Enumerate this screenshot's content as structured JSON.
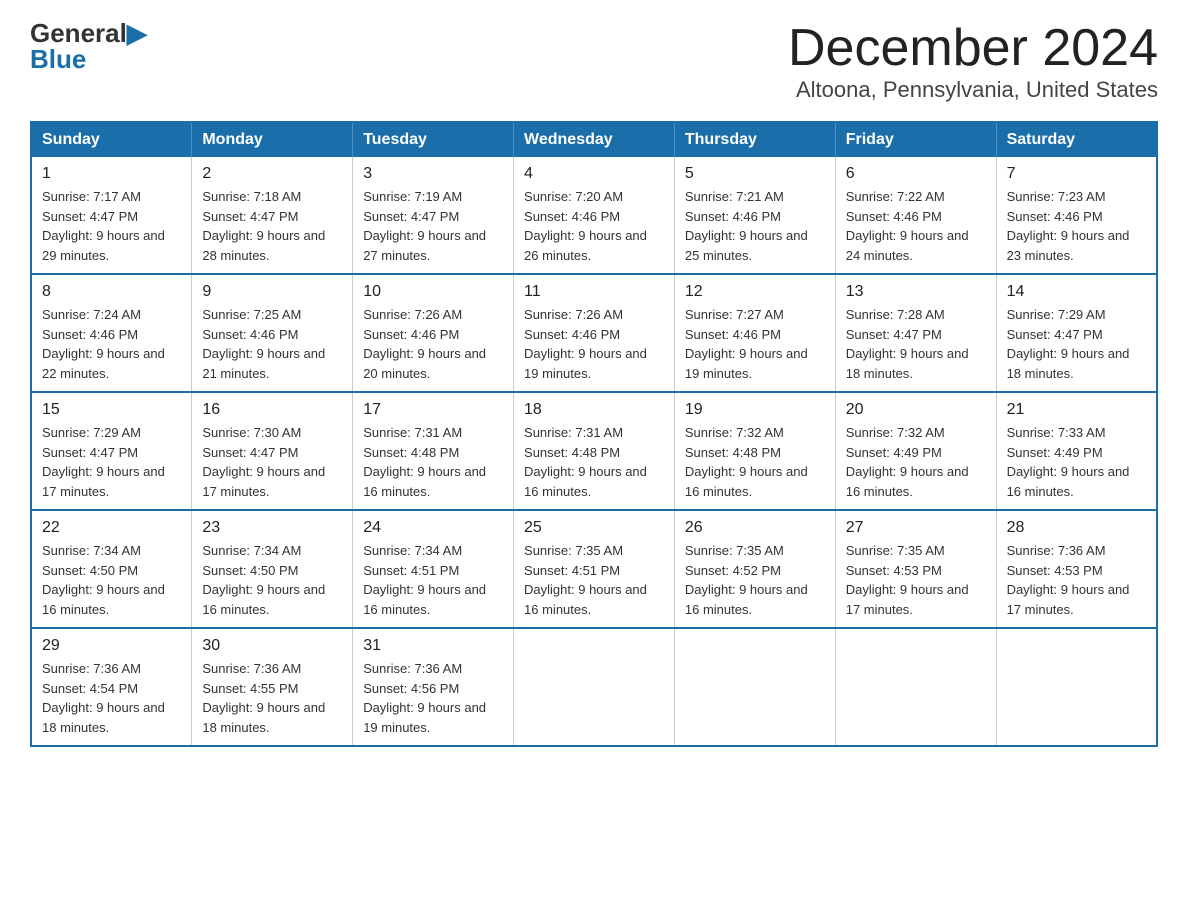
{
  "header": {
    "logo_general": "General",
    "logo_blue": "Blue",
    "title": "December 2024",
    "subtitle": "Altoona, Pennsylvania, United States"
  },
  "days_of_week": [
    "Sunday",
    "Monday",
    "Tuesday",
    "Wednesday",
    "Thursday",
    "Friday",
    "Saturday"
  ],
  "weeks": [
    [
      {
        "day": "1",
        "sunrise": "7:17 AM",
        "sunset": "4:47 PM",
        "daylight": "9 hours and 29 minutes."
      },
      {
        "day": "2",
        "sunrise": "7:18 AM",
        "sunset": "4:47 PM",
        "daylight": "9 hours and 28 minutes."
      },
      {
        "day": "3",
        "sunrise": "7:19 AM",
        "sunset": "4:47 PM",
        "daylight": "9 hours and 27 minutes."
      },
      {
        "day": "4",
        "sunrise": "7:20 AM",
        "sunset": "4:46 PM",
        "daylight": "9 hours and 26 minutes."
      },
      {
        "day": "5",
        "sunrise": "7:21 AM",
        "sunset": "4:46 PM",
        "daylight": "9 hours and 25 minutes."
      },
      {
        "day": "6",
        "sunrise": "7:22 AM",
        "sunset": "4:46 PM",
        "daylight": "9 hours and 24 minutes."
      },
      {
        "day": "7",
        "sunrise": "7:23 AM",
        "sunset": "4:46 PM",
        "daylight": "9 hours and 23 minutes."
      }
    ],
    [
      {
        "day": "8",
        "sunrise": "7:24 AM",
        "sunset": "4:46 PM",
        "daylight": "9 hours and 22 minutes."
      },
      {
        "day": "9",
        "sunrise": "7:25 AM",
        "sunset": "4:46 PM",
        "daylight": "9 hours and 21 minutes."
      },
      {
        "day": "10",
        "sunrise": "7:26 AM",
        "sunset": "4:46 PM",
        "daylight": "9 hours and 20 minutes."
      },
      {
        "day": "11",
        "sunrise": "7:26 AM",
        "sunset": "4:46 PM",
        "daylight": "9 hours and 19 minutes."
      },
      {
        "day": "12",
        "sunrise": "7:27 AM",
        "sunset": "4:46 PM",
        "daylight": "9 hours and 19 minutes."
      },
      {
        "day": "13",
        "sunrise": "7:28 AM",
        "sunset": "4:47 PM",
        "daylight": "9 hours and 18 minutes."
      },
      {
        "day": "14",
        "sunrise": "7:29 AM",
        "sunset": "4:47 PM",
        "daylight": "9 hours and 18 minutes."
      }
    ],
    [
      {
        "day": "15",
        "sunrise": "7:29 AM",
        "sunset": "4:47 PM",
        "daylight": "9 hours and 17 minutes."
      },
      {
        "day": "16",
        "sunrise": "7:30 AM",
        "sunset": "4:47 PM",
        "daylight": "9 hours and 17 minutes."
      },
      {
        "day": "17",
        "sunrise": "7:31 AM",
        "sunset": "4:48 PM",
        "daylight": "9 hours and 16 minutes."
      },
      {
        "day": "18",
        "sunrise": "7:31 AM",
        "sunset": "4:48 PM",
        "daylight": "9 hours and 16 minutes."
      },
      {
        "day": "19",
        "sunrise": "7:32 AM",
        "sunset": "4:48 PM",
        "daylight": "9 hours and 16 minutes."
      },
      {
        "day": "20",
        "sunrise": "7:32 AM",
        "sunset": "4:49 PM",
        "daylight": "9 hours and 16 minutes."
      },
      {
        "day": "21",
        "sunrise": "7:33 AM",
        "sunset": "4:49 PM",
        "daylight": "9 hours and 16 minutes."
      }
    ],
    [
      {
        "day": "22",
        "sunrise": "7:34 AM",
        "sunset": "4:50 PM",
        "daylight": "9 hours and 16 minutes."
      },
      {
        "day": "23",
        "sunrise": "7:34 AM",
        "sunset": "4:50 PM",
        "daylight": "9 hours and 16 minutes."
      },
      {
        "day": "24",
        "sunrise": "7:34 AM",
        "sunset": "4:51 PM",
        "daylight": "9 hours and 16 minutes."
      },
      {
        "day": "25",
        "sunrise": "7:35 AM",
        "sunset": "4:51 PM",
        "daylight": "9 hours and 16 minutes."
      },
      {
        "day": "26",
        "sunrise": "7:35 AM",
        "sunset": "4:52 PM",
        "daylight": "9 hours and 16 minutes."
      },
      {
        "day": "27",
        "sunrise": "7:35 AM",
        "sunset": "4:53 PM",
        "daylight": "9 hours and 17 minutes."
      },
      {
        "day": "28",
        "sunrise": "7:36 AM",
        "sunset": "4:53 PM",
        "daylight": "9 hours and 17 minutes."
      }
    ],
    [
      {
        "day": "29",
        "sunrise": "7:36 AM",
        "sunset": "4:54 PM",
        "daylight": "9 hours and 18 minutes."
      },
      {
        "day": "30",
        "sunrise": "7:36 AM",
        "sunset": "4:55 PM",
        "daylight": "9 hours and 18 minutes."
      },
      {
        "day": "31",
        "sunrise": "7:36 AM",
        "sunset": "4:56 PM",
        "daylight": "9 hours and 19 minutes."
      },
      null,
      null,
      null,
      null
    ]
  ]
}
